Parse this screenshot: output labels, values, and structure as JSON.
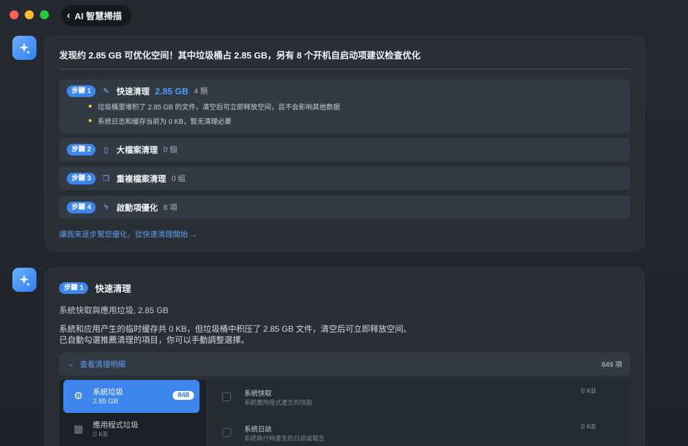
{
  "window": {
    "back_label": "AI 智慧掃描"
  },
  "summary": {
    "headline": "发现约 2.85 GB 可优化空间！其中垃圾桶占 2.85 GB，另有 8 个开机自启动项建议检查优化",
    "steps": [
      {
        "badge": "步驟 1",
        "title": "快速清理",
        "amount": "2.85 GB",
        "count": "4 類",
        "tips": [
          "垃圾桶里堆积了 2.85 GB 的文件，清空后可立即释放空间，且不会影响其他数据",
          "系統日志和缓存当前为 0 KB，暂无清理必要"
        ]
      },
      {
        "badge": "步驟 2",
        "title": "大檔案清理",
        "count": "0 個"
      },
      {
        "badge": "步驟 3",
        "title": "重複檔案清理",
        "count": "0 組"
      },
      {
        "badge": "步驟 4",
        "title": "啟動項優化",
        "count": "8 項"
      }
    ],
    "link": "讓我來逐步幫您優化，從快速清理開始 →"
  },
  "detail": {
    "badge": "步驟 1",
    "title": "快速清理",
    "subtitle": "系統快取與應用垃圾, 2.85 GB",
    "desc_line1": "系統和应用产生的临时缓存共 0 KB，但垃圾桶中积压了 2.85 GB 文件，清空后可立即释放空间。",
    "desc_line2": "已自動勾選推薦清理的項目，你可以手動調整選擇。",
    "expand_label": "查看清理明細",
    "total_count": "849 項",
    "categories": [
      {
        "name": "系統垃圾",
        "size": "2.85 GB",
        "badge": "848",
        "icon": "gear-icon"
      },
      {
        "name": "應用程式垃圾",
        "size": "0 KB",
        "icon": "grid-icon"
      }
    ],
    "items": [
      {
        "name": "系統快取",
        "desc": "系統應用程式產生的快取",
        "size": "0 KB"
      },
      {
        "name": "系統日誌",
        "desc": "系統執行時產生的日誌或報告",
        "size": "0 KB"
      }
    ]
  },
  "colors": {
    "accent": "#3d86ee",
    "link": "#5f9ff1",
    "bulb": "#f5c542"
  }
}
